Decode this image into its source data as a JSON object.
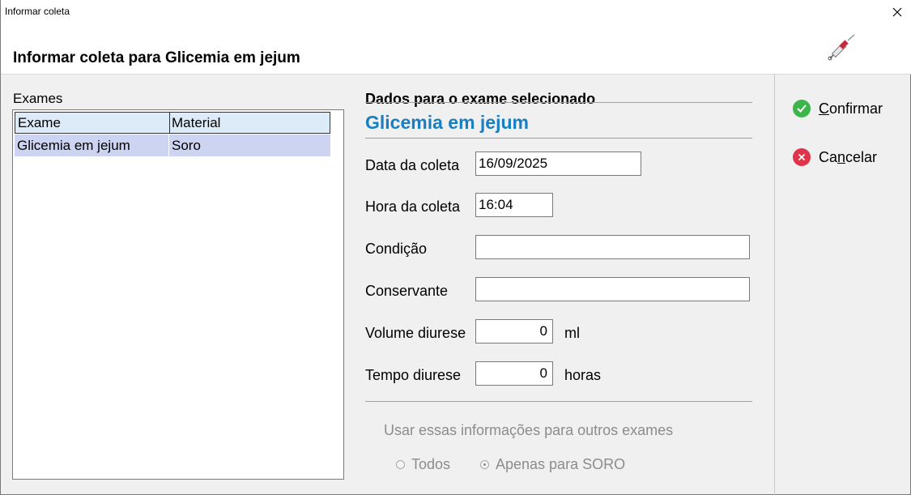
{
  "window": {
    "title": "Informar coleta"
  },
  "header": {
    "title": "Informar coleta para Glicemia em jejum"
  },
  "exams": {
    "label": "Exames",
    "columns": [
      "Exame",
      "Material"
    ],
    "rows": [
      {
        "exame": "Glicemia em jejum",
        "material": "Soro"
      }
    ]
  },
  "details": {
    "section_label": "Dados para o exame selecionado",
    "exam_name": "Glicemia em jejum",
    "data_label": "Data da coleta",
    "data_value": "16/09/2025",
    "hora_label": "Hora da coleta",
    "hora_value": "16:04",
    "condicao_label": "Condição",
    "condicao_value": "",
    "conservante_label": "Conservante",
    "conservante_value": "",
    "volume_label": "Volume diurese",
    "volume_value": "0",
    "volume_unit": "ml",
    "tempo_label": "Tempo diurese",
    "tempo_value": "0",
    "tempo_unit": "horas",
    "use_info_label": "Usar essas informações para outros exames",
    "radio_todos": "Todos",
    "radio_apenas": "Apenas para SORO"
  },
  "actions": {
    "confirm_first": "C",
    "confirm_rest": "onfirmar",
    "cancel_first": "Ca",
    "cancel_ul": "n",
    "cancel_rest": "celar"
  },
  "colors": {
    "accent": "#1a7fc1",
    "confirm": "#3cb54a",
    "cancel": "#e0344a",
    "selection": "#ccd4f2"
  }
}
